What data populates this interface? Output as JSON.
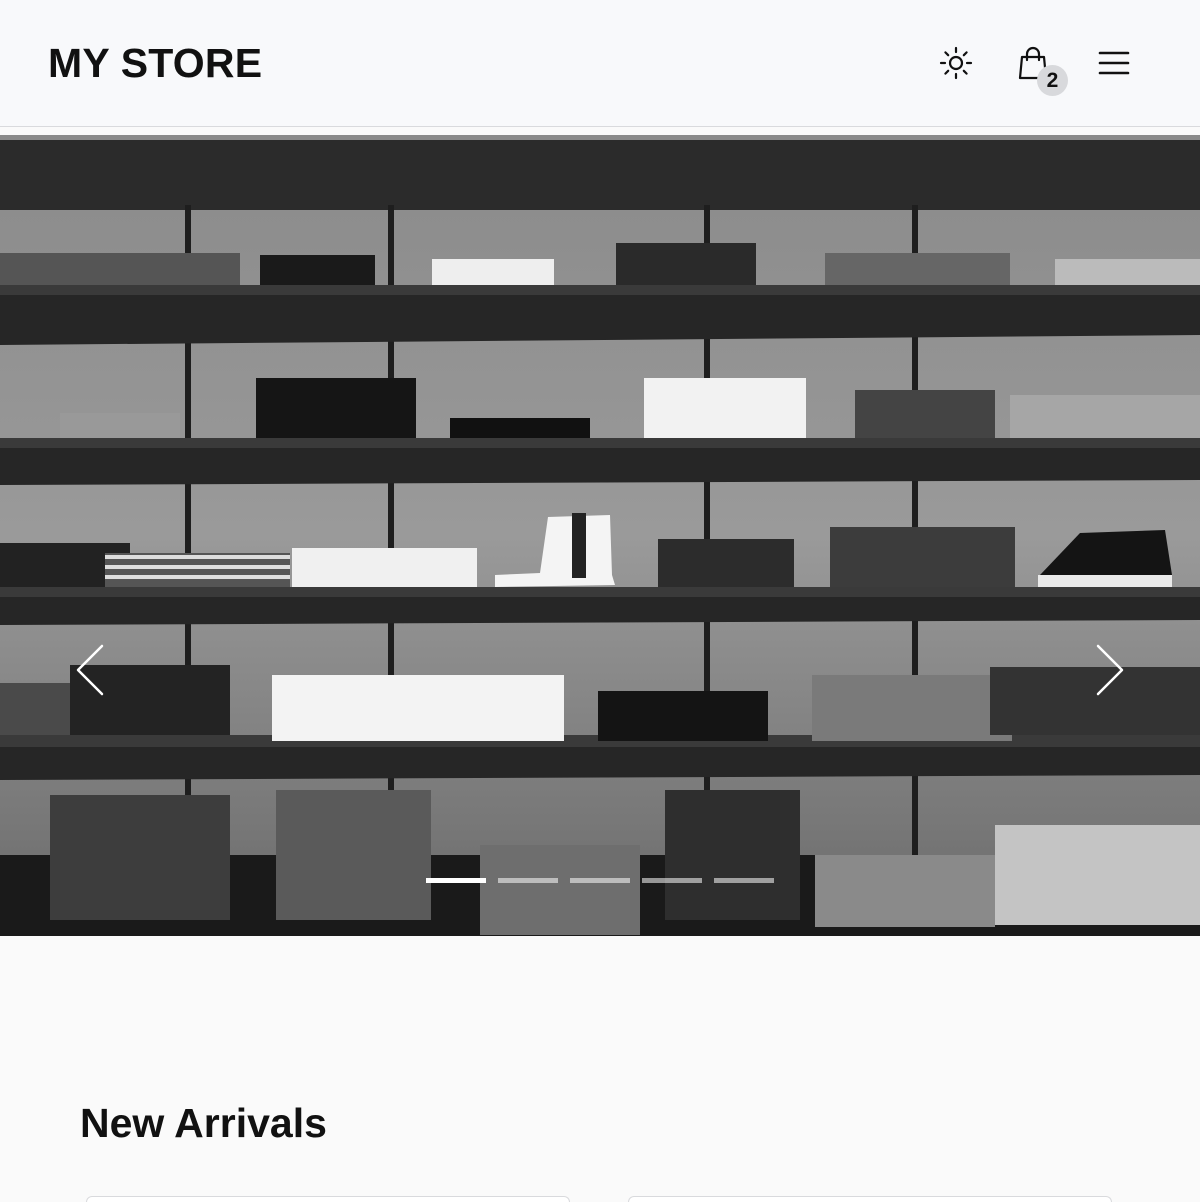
{
  "header": {
    "brand": "MY STORE",
    "cart_count": "2"
  },
  "icons": {
    "theme": "sun-icon",
    "cart": "shopping-bag-icon",
    "menu": "hamburger-menu-icon",
    "prev": "chevron-left-icon",
    "next": "chevron-right-icon"
  },
  "hero": {
    "image": "clothing-store-shelves-photo",
    "slides": 5,
    "active_slide": 1
  },
  "sections": {
    "new_arrivals_title": "New Arrivals"
  },
  "colors": {
    "header_bg": "#f8f9fb",
    "page_bg": "#fafafa",
    "badge_bg": "#d8d9dc",
    "text": "#111111"
  }
}
